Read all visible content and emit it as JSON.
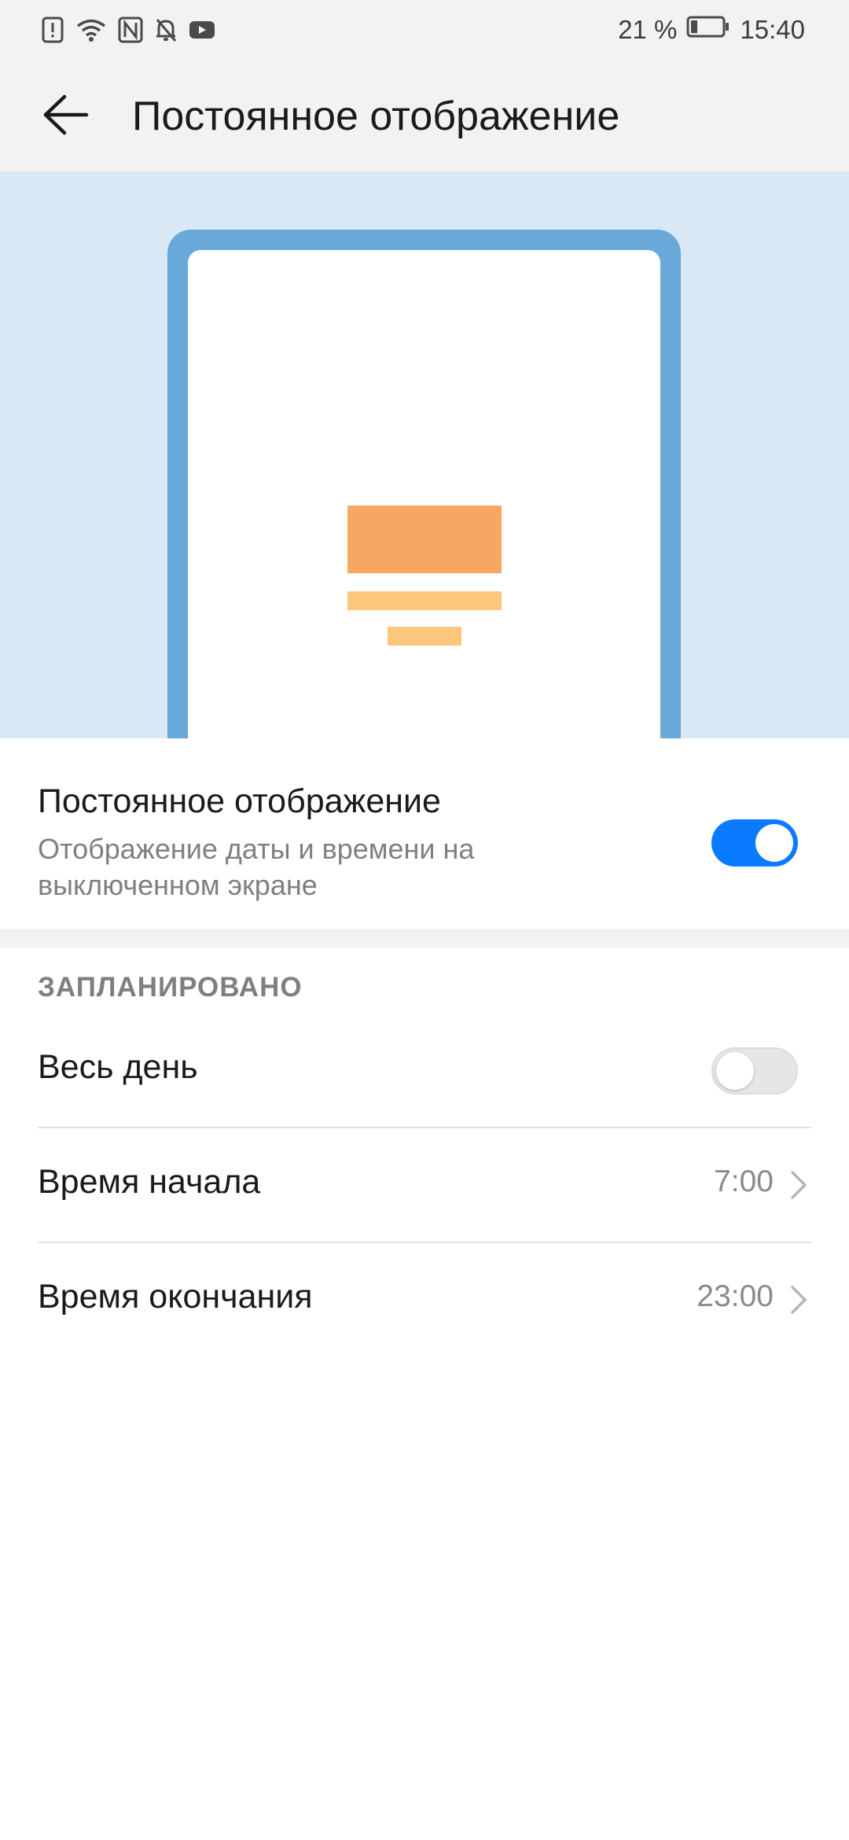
{
  "status_bar": {
    "icons": [
      "alert-icon",
      "wifi-icon",
      "nfc-icon",
      "bell-off-icon",
      "youtube-icon"
    ],
    "battery_percent": "21 %",
    "battery_level": 0.21,
    "time": "15:40"
  },
  "header": {
    "title": "Постоянное отображение",
    "back_icon": "arrow-left-icon"
  },
  "preview": {
    "background": "#d8e9f5",
    "frame_color": "#68a9d9",
    "block_color": "#f6a863",
    "bar_color": "#fdc77b"
  },
  "always_on": {
    "title": "Постоянное отображение",
    "subtitle": "Отображение даты и времени на выключенном экране",
    "enabled": true,
    "accent": "#0a7aff"
  },
  "schedule": {
    "section_title": "ЗАПЛАНИРОВАНО",
    "all_day": {
      "label": "Весь день",
      "enabled": false
    },
    "start": {
      "label": "Время начала",
      "value": "7:00"
    },
    "end": {
      "label": "Время окончания",
      "value": "23:00"
    }
  }
}
